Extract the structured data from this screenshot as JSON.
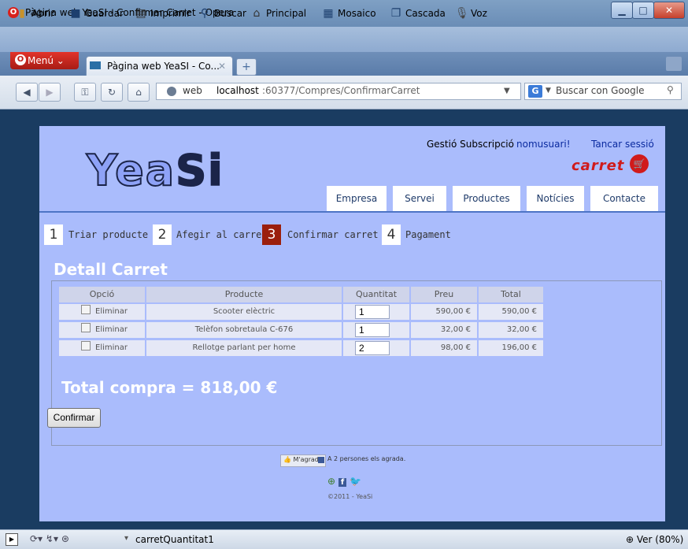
{
  "window": {
    "title": "Pàgina web YeaSI - Confirmar Carret - Opera",
    "app_icon": "opera-icon"
  },
  "menubar": {
    "items": [
      {
        "label": "Abrir",
        "icon": "open-icon"
      },
      {
        "label": "Guardar",
        "icon": "save-icon"
      },
      {
        "label": "Imprimir",
        "icon": "print-icon"
      },
      {
        "label": "Buscar",
        "icon": "search-icon"
      },
      {
        "label": "Principal",
        "icon": "home-icon"
      },
      {
        "label": "Mosaico",
        "icon": "tile-icon"
      },
      {
        "label": "Cascada",
        "icon": "cascade-icon"
      },
      {
        "label": "Voz",
        "icon": "microphone-icon"
      }
    ]
  },
  "tabs": {
    "menu_label": "Menú",
    "active_tab": "Pàgina web YeaSI - Co..."
  },
  "address": {
    "scheme_label": "web",
    "host": "localhost",
    "path": ":60377/Compres/ConfirmarCarret",
    "search_placeholder": "Buscar con Google"
  },
  "site": {
    "logo_text": "Yea",
    "logo_text_2": "Si",
    "management_label": "Gestió Subscripció",
    "username": "nomusuari!",
    "logout": "Tancar sessió",
    "cart_logo": "carret",
    "nav": [
      "Empresa",
      "Servei",
      "Productes",
      "Notícies",
      "Contacte"
    ],
    "steps": [
      {
        "num": "1",
        "label": "Triar producte"
      },
      {
        "num": "2",
        "label": "Afegir al carret"
      },
      {
        "num": "3",
        "label": "Confirmar carret"
      },
      {
        "num": "4",
        "label": "Pagament"
      }
    ],
    "detail_title": "Detall Carret",
    "table": {
      "headers": [
        "Opció",
        "Producte",
        "Quantitat",
        "Preu",
        "Total"
      ],
      "rows": [
        {
          "option": "Eliminar",
          "product": "Scooter elèctric",
          "qty": "1",
          "price": "590,00 €",
          "total": "590,00 €"
        },
        {
          "option": "Eliminar",
          "product": "Telèfon sobretaula C-676",
          "qty": "1",
          "price": "32,00 €",
          "total": "32,00 €"
        },
        {
          "option": "Eliminar",
          "product": "Rellotge parlant per home",
          "qty": "2",
          "price": "98,00 €",
          "total": "196,00 €"
        }
      ]
    },
    "total_text": "Total compra = 818,00 €",
    "confirm_button": "Confirmar",
    "footer": {
      "like_button": "M'agrada",
      "like_count": "A 2 persones els agrada.",
      "copyright": "©2011 - YeaSi"
    }
  },
  "statusbar": {
    "text": "carretQuantitat1",
    "zoom": "Ver (80%)"
  }
}
